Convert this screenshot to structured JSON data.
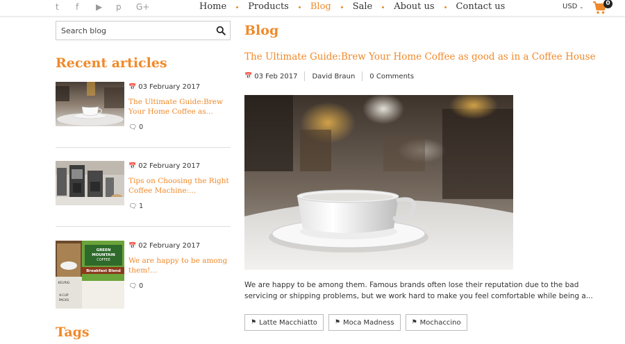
{
  "header": {
    "social_icons": [
      "twitter-icon",
      "facebook-icon",
      "youtube-icon",
      "pinterest-icon",
      "google-plus-icon"
    ],
    "social_glyphs": [
      "t",
      "f",
      "▶",
      "p",
      "G+"
    ],
    "nav": [
      {
        "label": "Home",
        "active": false
      },
      {
        "label": "Products",
        "active": false
      },
      {
        "label": "Blog",
        "active": true
      },
      {
        "label": "Sale",
        "active": false
      },
      {
        "label": "About us",
        "active": false
      },
      {
        "label": "Contact us",
        "active": false
      }
    ],
    "currency": "USD",
    "cart_count": "0"
  },
  "sidebar": {
    "search": {
      "placeholder": "Search blog",
      "value": ""
    },
    "recent_title": "Recent articles",
    "articles": [
      {
        "date": "03 February 2017",
        "title": "The Ultimate Guide:Brew Your Home Coffee as...",
        "comments": "0",
        "thumb": "coffee-cup-thumbnail"
      },
      {
        "date": "02 February 2017",
        "title": "Tips on Choosing the Right Coffee Machine:...",
        "comments": "1",
        "thumb": "coffee-machine-thumbnail"
      },
      {
        "date": "02 February 2017",
        "title": "We are happy to be among them!...",
        "comments": "0",
        "thumb": "green-mountain-coffee-box-thumbnail"
      }
    ],
    "tags_title": "Tags",
    "thumb_texts": {
      "brand1": "GREEN",
      "brand2": "MOUNTAIN",
      "brand3": "COFFEE",
      "product": "Breakfast Blend",
      "maker": "KEURIG",
      "pack1": "K-CUP",
      "pack2": "PACKS"
    }
  },
  "main": {
    "page_title": "Blog",
    "post": {
      "title": "The Ultimate Guide:Brew Your Home Coffee as good as in a Coffee House",
      "date": "03 Feb 2017",
      "author": "David Braun",
      "comments": "0 Comments",
      "image": "coffee-cup-on-table-photo",
      "excerpt": "We are happy to be among them. Famous brands often lose their reputation due to the bad servicing or shipping problems, but we work hard to make you feel comfortable while being a...",
      "tags": [
        "Latte Macchiatto",
        "Moca Madness",
        "Mochaccino"
      ]
    }
  },
  "colors": {
    "accent": "#f0892a",
    "text": "#333333",
    "border": "#cccccc"
  }
}
